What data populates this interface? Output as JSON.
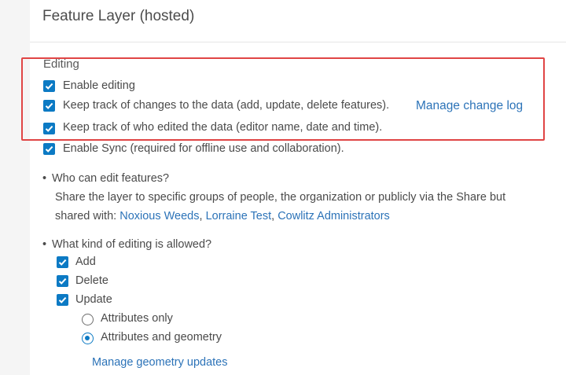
{
  "header": {
    "title": "Feature Layer (hosted)"
  },
  "editing": {
    "label": "Editing",
    "enable_editing": "Enable editing",
    "track_changes": "Keep track of changes to the data (add, update, delete features).",
    "manage_change_log": "Manage change log",
    "track_editors": "Keep track of who edited the data (editor name, date and time).",
    "enable_sync": "Enable Sync (required for offline use and collaboration)."
  },
  "who_can_edit": {
    "bullet": "•",
    "question": "Who can edit features?",
    "description": "Share the layer to specific groups of people, the organization or publicly via the Share but",
    "shared_with_label": "shared with:",
    "groups": [
      "Noxious Weeds",
      "Lorraine Test",
      "Cowlitz Administrators"
    ],
    "separator": ","
  },
  "editing_allowed": {
    "bullet": "•",
    "question": "What kind of editing is allowed?",
    "add": "Add",
    "delete": "Delete",
    "update": "Update",
    "attributes_only": "Attributes only",
    "attributes_and_geometry": "Attributes and geometry",
    "manage_geometry_updates": "Manage geometry updates"
  },
  "colors": {
    "accent": "#0c7ac4",
    "link": "#2c73b8",
    "highlight": "#e04545"
  }
}
